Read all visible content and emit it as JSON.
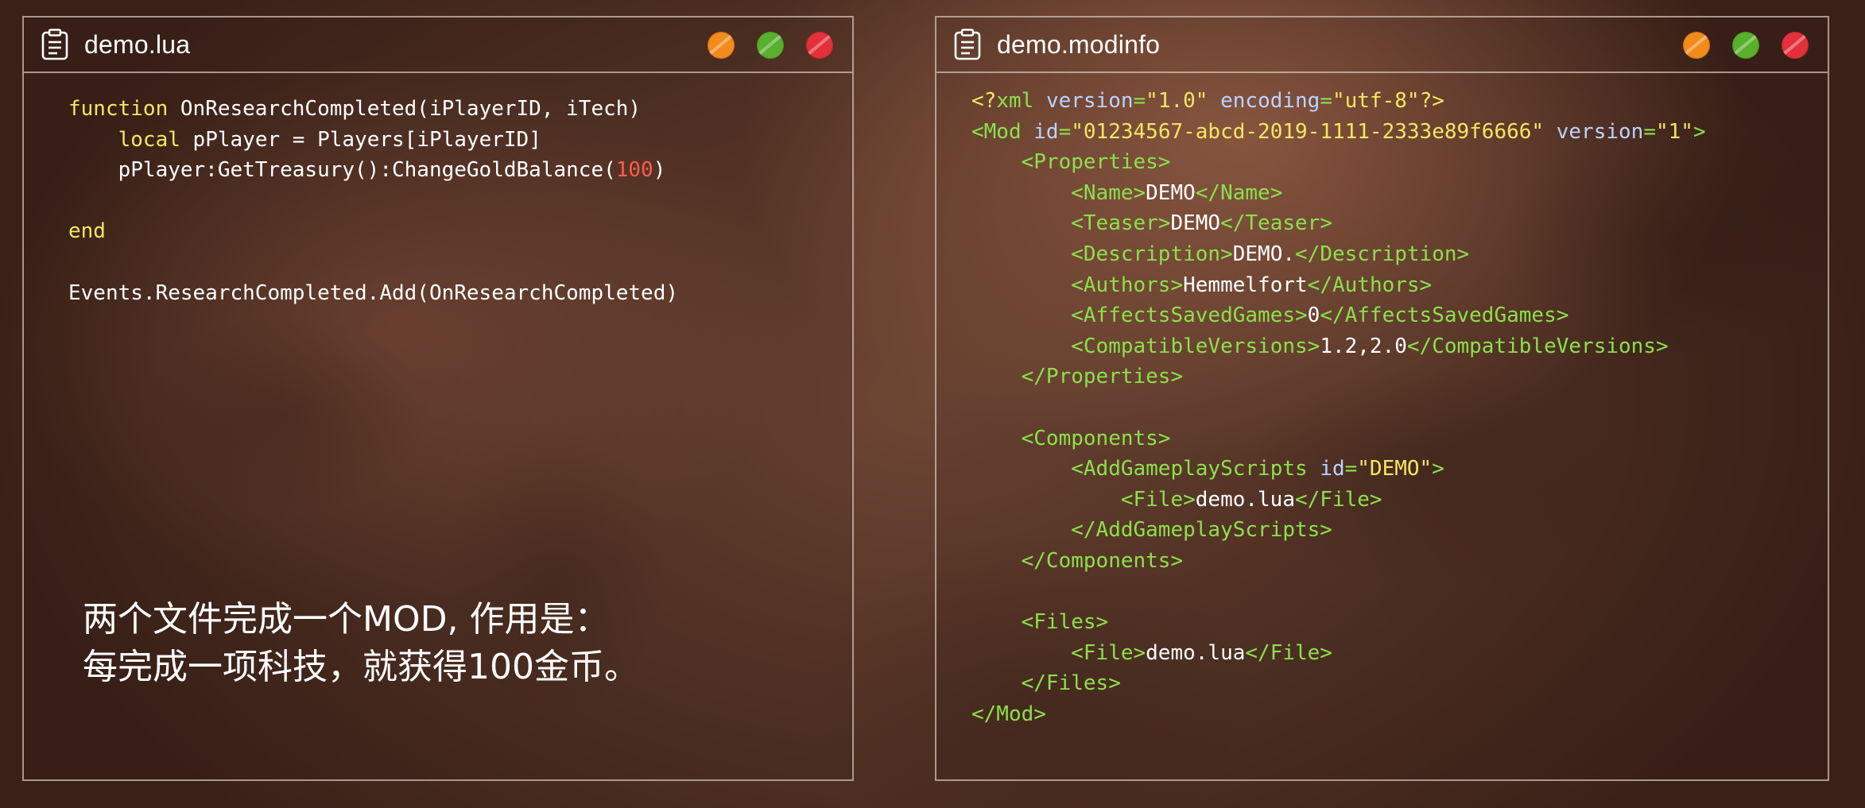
{
  "windows": {
    "lua": {
      "title": "demo.lua",
      "icon": "clipboard-icon",
      "code": {
        "l1_kw": "function",
        "l1_rest": " OnResearchCompleted(iPlayerID, iTech)",
        "l2_indent": "    ",
        "l2_kw": "local",
        "l2_rest": " pPlayer = Players[iPlayerID]",
        "l3_pre": "    pPlayer:GetTreasury():ChangeGoldBalance(",
        "l3_num": "100",
        "l3_post": ")",
        "l5_kw": "end",
        "l7": "Events.ResearchCompleted.Add(OnResearchCompleted)"
      },
      "caption_line1": "两个文件完成一个MOD, 作用是：",
      "caption_line2": "每完成一项科技，就获得100金币。"
    },
    "modinfo": {
      "title": "demo.modinfo",
      "icon": "clipboard-icon",
      "code": {
        "decl_open": "<?",
        "decl_name": "xml",
        "decl_attr1": "version",
        "decl_val1": "\"1.0\"",
        "decl_attr2": "encoding",
        "decl_val2": "\"utf-8\"",
        "decl_close": "?>",
        "mod_open": "<Mod",
        "mod_attr_id": "id",
        "mod_val_id": "\"01234567-abcd-2019-1111-2333e89f6666\"",
        "mod_attr_version": "version",
        "mod_val_version": "\"1\"",
        "mod_gt": ">",
        "properties_open": "<Properties>",
        "name_open": "<Name>",
        "name_val": "DEMO",
        "name_close": "</Name>",
        "teaser_open": "<Teaser>",
        "teaser_val": "DEMO",
        "teaser_close": "</Teaser>",
        "desc_open": "<Description>",
        "desc_val": "DEMO.",
        "desc_close": "</Description>",
        "authors_open": "<Authors>",
        "authors_val": "Hemmelfort",
        "authors_close": "</Authors>",
        "affects_open": "<AffectsSavedGames>",
        "affects_val": "0",
        "affects_close": "</AffectsSavedGames>",
        "compat_open": "<CompatibleVersions>",
        "compat_val": "1.2,2.0",
        "compat_close": "</CompatibleVersions>",
        "properties_close": "</Properties>",
        "components_open": "<Components>",
        "ags_open": "<AddGameplayScripts",
        "ags_attr": "id",
        "ags_val": "\"DEMO\"",
        "ags_gt": ">",
        "file1_open": "<File>",
        "file1_val": "demo.lua",
        "file1_close": "</File>",
        "ags_close": "</AddGameplayScripts>",
        "components_close": "</Components>",
        "files_open": "<Files>",
        "file2_open": "<File>",
        "file2_val": "demo.lua",
        "file2_close": "</File>",
        "files_close": "</Files>",
        "mod_close": "</Mod>"
      }
    }
  },
  "window_buttons": [
    "minimize-orange",
    "maximize-green",
    "close-red"
  ],
  "colors": {
    "keyword": "#f5e663",
    "number": "#ff5c4e",
    "xml_tag": "#8ce04c",
    "xml_attr": "#bcd2ff",
    "xml_string": "#f5e663",
    "text": "#ffffff",
    "dot_orange": "#f28a1c",
    "dot_green": "#58b02d",
    "dot_red": "#e3303a"
  }
}
